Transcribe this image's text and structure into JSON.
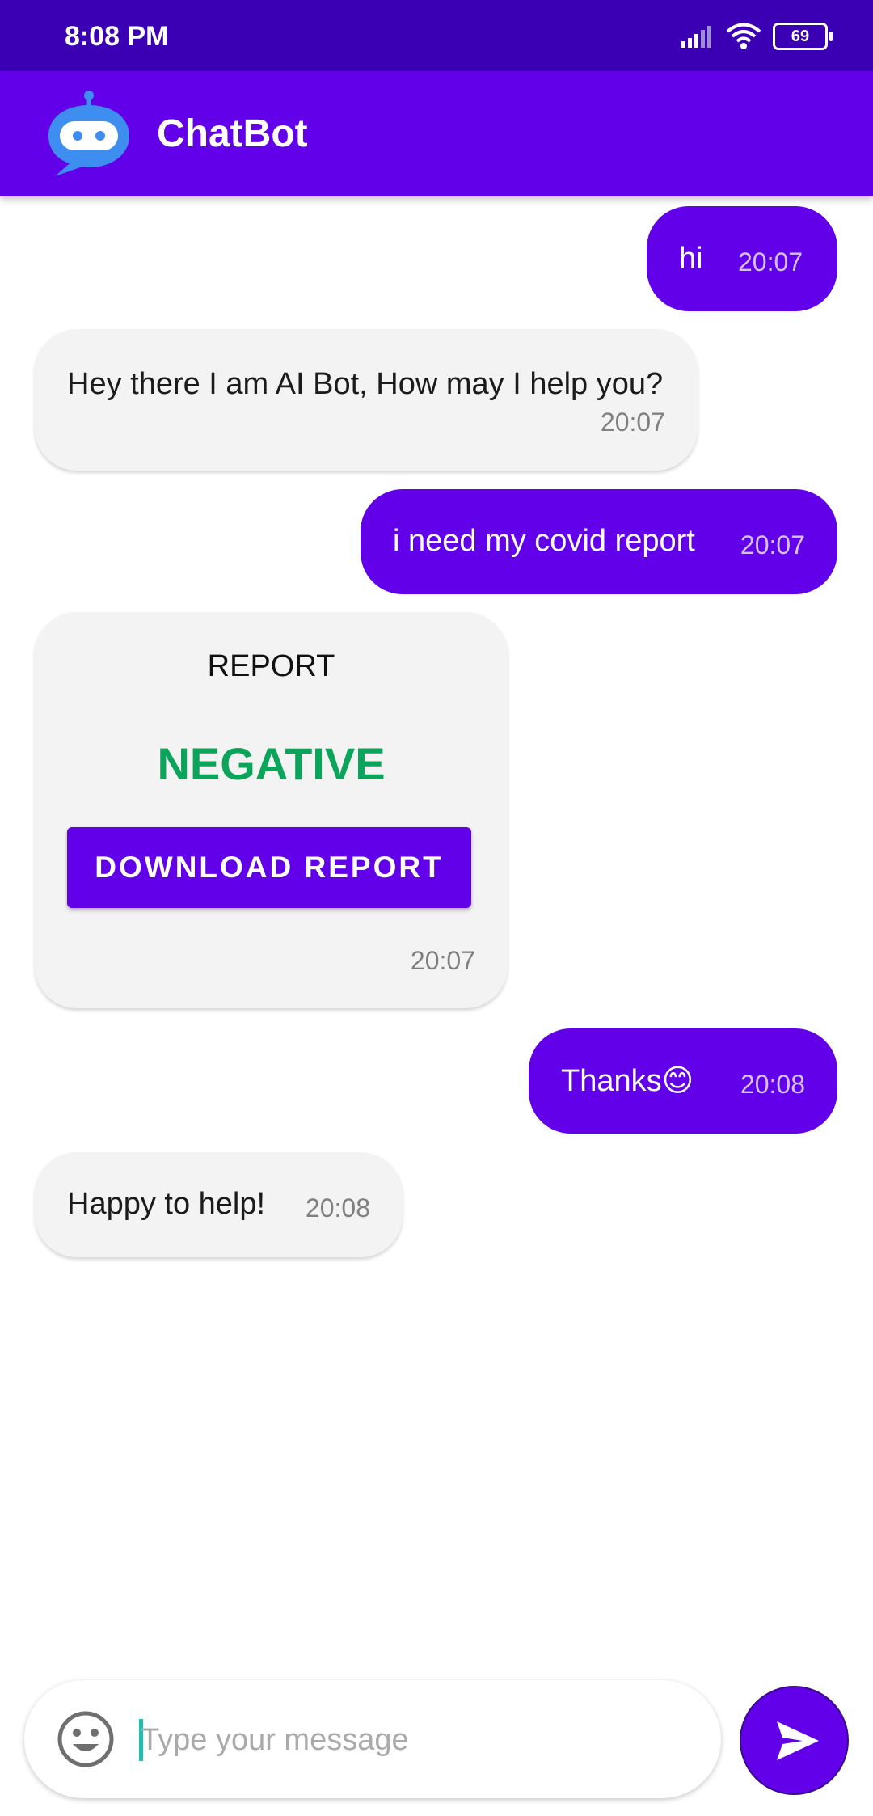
{
  "status_bar": {
    "time": "8:08 PM",
    "battery": "69"
  },
  "app_bar": {
    "title": "ChatBot",
    "logo_icon": "robot-chat-icon"
  },
  "messages": [
    {
      "sender": "user",
      "text": "hi",
      "time": "20:07"
    },
    {
      "sender": "bot",
      "text": "Hey there I am AI Bot, How may I help you?",
      "time": "20:07"
    },
    {
      "sender": "user",
      "text": "i need my covid report",
      "time": "20:07"
    },
    {
      "sender": "bot",
      "type": "report",
      "heading": "REPORT",
      "result": "NEGATIVE",
      "button": "DOWNLOAD REPORT",
      "time": "20:07"
    },
    {
      "sender": "user",
      "text": "Thanks😊",
      "time": "20:08"
    },
    {
      "sender": "bot",
      "text": "Happy to help!",
      "time": "20:08"
    }
  ],
  "composer": {
    "placeholder": "Type your message",
    "emoji_icon": "smiley-icon",
    "send_icon": "send-icon"
  },
  "colors": {
    "primary": "#6200ea",
    "status_bar": "#3b00b4",
    "bot_bubble": "#f3f3f3",
    "result_negative": "#0aa45a"
  }
}
